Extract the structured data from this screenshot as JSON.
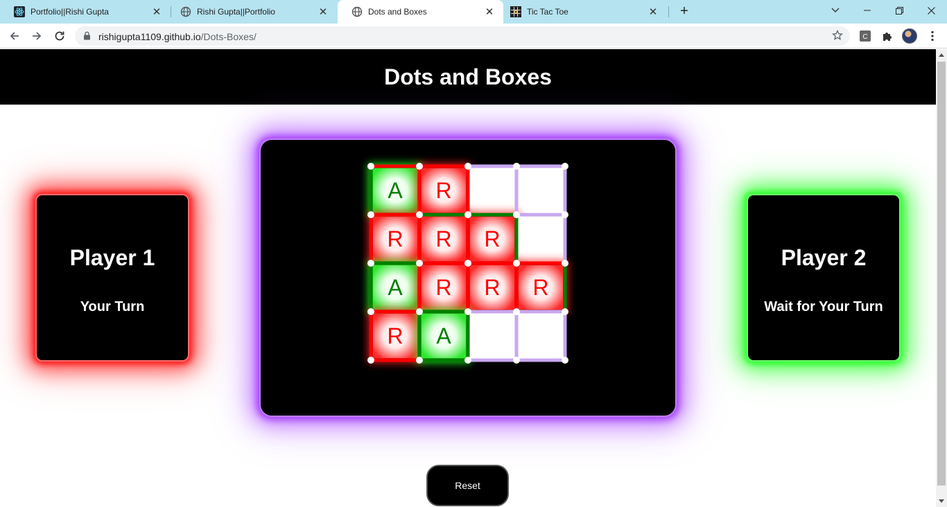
{
  "browser": {
    "tabs": [
      {
        "title": "Portfolio||Rishi Gupta",
        "favicon": "react-icon",
        "active": false
      },
      {
        "title": "Rishi Gupta||Portfolio",
        "favicon": "globe-icon",
        "active": false
      },
      {
        "title": "Dots and Boxes",
        "favicon": "globe-icon",
        "active": true
      },
      {
        "title": "Tic Tac Toe",
        "favicon": "tictactoe-icon",
        "active": false
      }
    ],
    "url_host": "rishigupta1109.github.io",
    "url_path": "/Dots-Boxes/"
  },
  "page": {
    "title": "Dots and Boxes",
    "player1": {
      "name": "Player 1",
      "status": "Your Turn",
      "color": "#ff2020"
    },
    "player2": {
      "name": "Player 2",
      "status": "Wait for Your Turn",
      "color": "#30ff30"
    },
    "reset_label": "Reset"
  },
  "game": {
    "grid_size": [
      4,
      4
    ],
    "colors": {
      "R": "#ff0000",
      "A": "#008000",
      "empty_line": "#c8a8f0"
    },
    "boxes": [
      [
        "A",
        "R",
        "",
        ""
      ],
      [
        "R",
        "R",
        "R",
        ""
      ],
      [
        "A",
        "R",
        "R",
        "R"
      ],
      [
        "R",
        "A",
        "",
        ""
      ]
    ],
    "h_lines": [
      [
        "R",
        "R",
        "",
        ""
      ],
      [
        "R",
        "A",
        "A",
        ""
      ],
      [
        "A",
        "R",
        "R",
        "R"
      ],
      [
        "R",
        "A",
        "",
        ""
      ],
      [
        "R",
        "A",
        "",
        ""
      ]
    ],
    "v_lines": [
      [
        "A",
        "R",
        "R",
        "",
        ""
      ],
      [
        "R",
        "R",
        "R",
        "A",
        ""
      ],
      [
        "A",
        "R",
        "R",
        "R",
        "A"
      ],
      [
        "R",
        "A",
        "A",
        "",
        ""
      ]
    ]
  }
}
